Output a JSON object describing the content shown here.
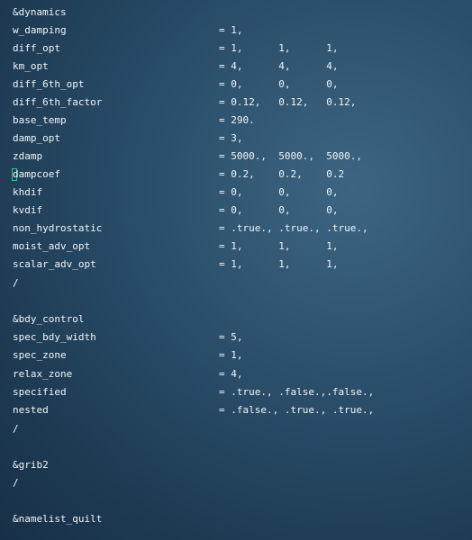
{
  "editor": {
    "lines": [
      {
        "key": "&dynamics",
        "value": ""
      },
      {
        "key": "w_damping",
        "value": "= 1,"
      },
      {
        "key": "diff_opt",
        "value": "= 1,      1,      1,"
      },
      {
        "key": "km_opt",
        "value": "= 4,      4,      4,"
      },
      {
        "key": "diff_6th_opt",
        "value": "= 0,      0,      0,"
      },
      {
        "key": "diff_6th_factor",
        "value": "= 0.12,   0.12,   0.12,"
      },
      {
        "key": "base_temp",
        "value": "= 290."
      },
      {
        "key": "damp_opt",
        "value": "= 3,"
      },
      {
        "key": "zdamp",
        "value": "= 5000.,  5000.,  5000.,"
      },
      {
        "key": "dampcoef",
        "value": "= 0.2,    0.2,    0.2"
      },
      {
        "key": "khdif",
        "value": "= 0,      0,      0,"
      },
      {
        "key": "kvdif",
        "value": "= 0,      0,      0,"
      },
      {
        "key": "non_hydrostatic",
        "value": "= .true., .true., .true.,"
      },
      {
        "key": "moist_adv_opt",
        "value": "= 1,      1,      1,"
      },
      {
        "key": "scalar_adv_opt",
        "value": "= 1,      1,      1,"
      },
      {
        "key": "/",
        "value": ""
      },
      {
        "key": "",
        "value": ""
      },
      {
        "key": "&bdy_control",
        "value": ""
      },
      {
        "key": "spec_bdy_width",
        "value": "= 5,"
      },
      {
        "key": "spec_zone",
        "value": "= 1,"
      },
      {
        "key": "relax_zone",
        "value": "= 4,"
      },
      {
        "key": "specified",
        "value": "= .true., .false.,.false.,"
      },
      {
        "key": "nested",
        "value": "= .false., .true., .true.,"
      },
      {
        "key": "/",
        "value": ""
      },
      {
        "key": "",
        "value": ""
      },
      {
        "key": "&grib2",
        "value": ""
      },
      {
        "key": "/",
        "value": ""
      },
      {
        "key": "",
        "value": ""
      },
      {
        "key": "&namelist_quilt",
        "value": ""
      }
    ]
  },
  "colors": {
    "text": "#f2f5f8",
    "cursor": "#34c27a",
    "background": "#2b4f6b"
  }
}
